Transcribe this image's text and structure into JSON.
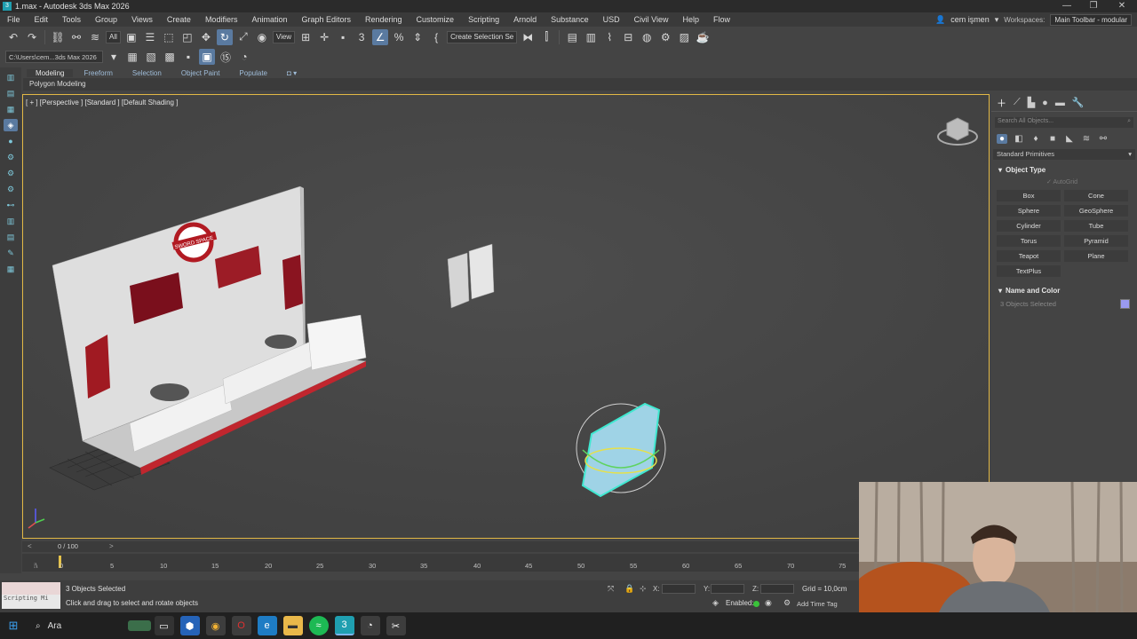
{
  "window": {
    "title": "1.max - Autodesk 3ds Max 2026",
    "minimize": "—",
    "maximize": "❐",
    "close": "✕"
  },
  "menu": [
    "File",
    "Edit",
    "Tools",
    "Group",
    "Views",
    "Create",
    "Modifiers",
    "Animation",
    "Graph Editors",
    "Rendering",
    "Customize",
    "Scripting",
    "Arnold",
    "Substance",
    "USD",
    "Civil View",
    "Help",
    "Flow"
  ],
  "user": {
    "name": "cem işmen",
    "workspace_label": "Workspaces:",
    "workspace_value": "Main Toolbar - modular"
  },
  "toolbar": {
    "selection_filter": "All",
    "ref_coord": "View",
    "named_selection": "Create Selection Se",
    "path": "C:\\Users\\cem...3ds Max 2026"
  },
  "ribbon": {
    "tabs": [
      "Modeling",
      "Freeform",
      "Selection",
      "Object Paint",
      "Populate"
    ],
    "panel_label": "Polygon Modeling"
  },
  "viewport": {
    "label": "[ + ] [Perspective ] [Standard ] [Default Shading ]",
    "sign_text": "SWORD SPACE"
  },
  "command_panel": {
    "search_placeholder": "Search All Objects...",
    "category_dropdown": "Standard Primitives",
    "object_type_title": "Object Type",
    "autogrid_label": "AutoGrid",
    "primitives": [
      "Box",
      "Cone",
      "Sphere",
      "GeoSphere",
      "Cylinder",
      "Tube",
      "Torus",
      "Pyramid",
      "Teapot",
      "Plane",
      "TextPlus"
    ],
    "name_color_title": "Name and Color",
    "name_field": "3 Objects Selected",
    "object_color": "#9a9af0"
  },
  "timeline": {
    "time_slider": "0 / 100",
    "ticks": [
      "0",
      "5",
      "10",
      "15",
      "20",
      "25",
      "30",
      "35",
      "40",
      "45",
      "50",
      "55",
      "60",
      "65",
      "70",
      "75"
    ]
  },
  "status": {
    "maxscript": "Scripting Mi",
    "selection": "3 Objects Selected",
    "prompt": "Click and drag to select and rotate objects",
    "x_label": "X:",
    "y_label": "Y:",
    "z_label": "Z:",
    "grid": "Grid = 10,0cm",
    "enabled": "Enabled:",
    "add_time_tag": "Add Time Tag"
  },
  "taskbar": {
    "search": "Ara"
  },
  "colors": {
    "accent": "#5a7aa0",
    "viewport_border": "#e2b845",
    "selection": "#3fe8d0"
  }
}
